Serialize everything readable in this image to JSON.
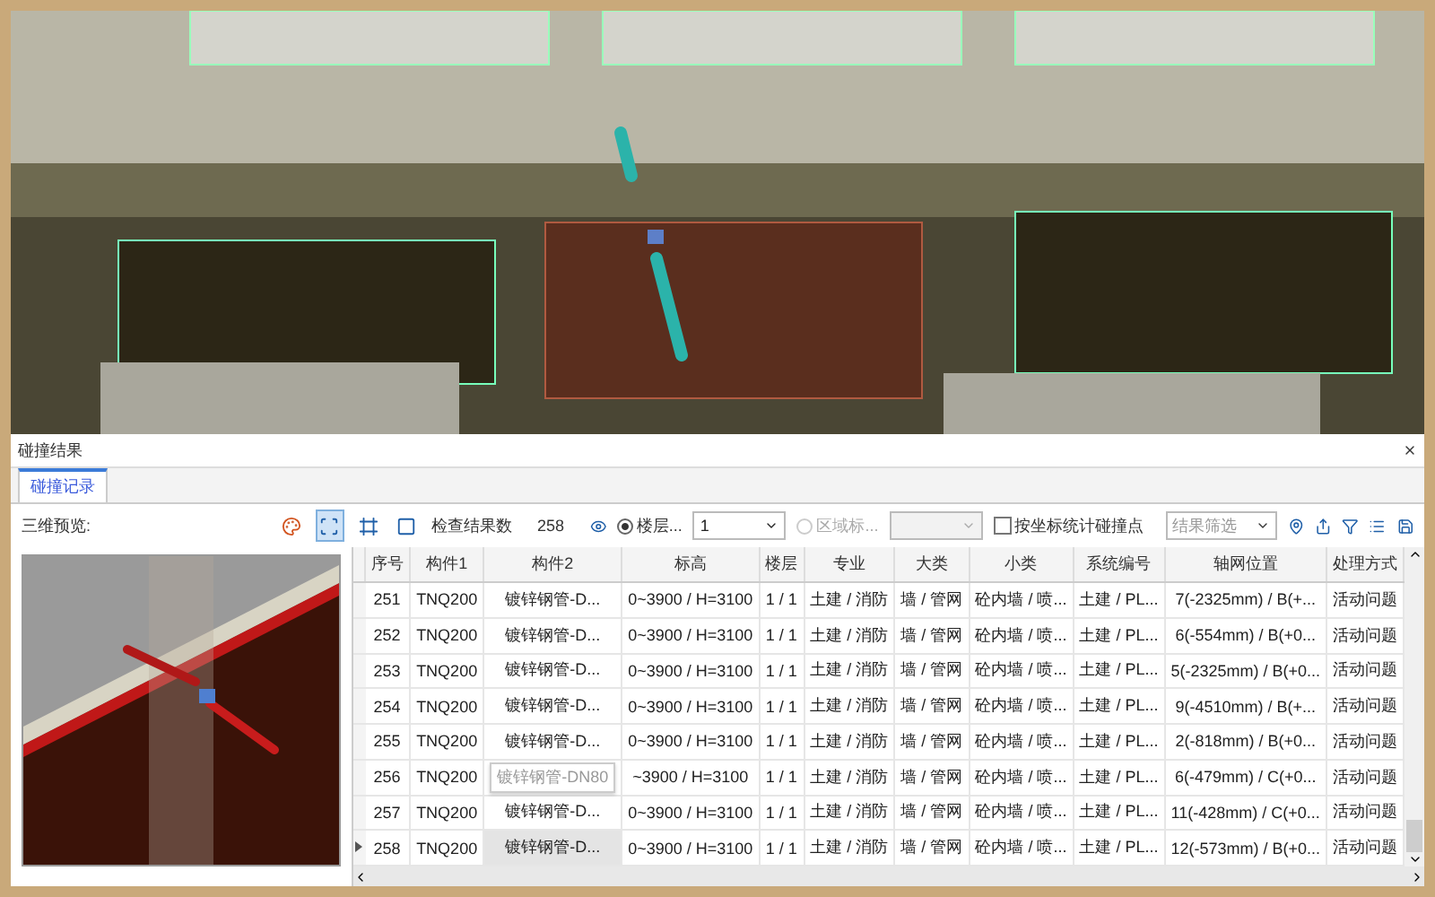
{
  "panel": {
    "title": "碰撞结果"
  },
  "tabs": [
    {
      "label": "碰撞记录",
      "selected": true
    }
  ],
  "toolbar": {
    "preview_label": "三维预览:",
    "tools": [
      {
        "kind": "color",
        "selected": false
      },
      {
        "kind": "fit",
        "selected": true
      },
      {
        "kind": "frame",
        "selected": false
      },
      {
        "kind": "window",
        "selected": false
      }
    ],
    "count_label": "检查结果数",
    "count": "258",
    "floor_radio": {
      "label": "楼层...",
      "selected": true
    },
    "floor_select": {
      "value": "1"
    },
    "area_radio": {
      "label": "区域标...",
      "selected": false,
      "disabled": true
    },
    "stat_checkbox": {
      "label": "按坐标统计碰撞点",
      "checked": false
    },
    "filter_select": {
      "placeholder": "结果筛选"
    }
  },
  "table": {
    "columns": [
      "序号",
      "构件1",
      "构件2",
      "标高",
      "楼层",
      "专业",
      "大类",
      "小类",
      "系统编号",
      "轴网位置",
      "处理方式"
    ],
    "rows": [
      {
        "selected": false,
        "hovered": false,
        "cells": [
          "251",
          "TNQ200",
          "镀锌钢管-D...",
          "0~3900 / H=3100",
          "1 / 1",
          "土建 / 消防",
          "墙 / 管网",
          "砼内墙 / 喷...",
          "土建 / PL...",
          "7(-2325mm) / B(+...",
          "活动问题"
        ]
      },
      {
        "selected": false,
        "hovered": false,
        "cells": [
          "252",
          "TNQ200",
          "镀锌钢管-D...",
          "0~3900 / H=3100",
          "1 / 1",
          "土建 / 消防",
          "墙 / 管网",
          "砼内墙 / 喷...",
          "土建 / PL...",
          "6(-554mm) / B(+0...",
          "活动问题"
        ]
      },
      {
        "selected": false,
        "hovered": false,
        "cells": [
          "253",
          "TNQ200",
          "镀锌钢管-D...",
          "0~3900 / H=3100",
          "1 / 1",
          "土建 / 消防",
          "墙 / 管网",
          "砼内墙 / 喷...",
          "土建 / PL...",
          "5(-2325mm) / B(+0...",
          "活动问题"
        ]
      },
      {
        "selected": false,
        "hovered": false,
        "cells": [
          "254",
          "TNQ200",
          "镀锌钢管-D...",
          "0~3900 / H=3100",
          "1 / 1",
          "土建 / 消防",
          "墙 / 管网",
          "砼内墙 / 喷...",
          "土建 / PL...",
          "9(-4510mm) / B(+...",
          "活动问题"
        ]
      },
      {
        "selected": false,
        "hovered": false,
        "cells": [
          "255",
          "TNQ200",
          "镀锌钢管-D...",
          "0~3900 / H=3100",
          "1 / 1",
          "土建 / 消防",
          "墙 / 管网",
          "砼内墙 / 喷...",
          "土建 / PL...",
          "2(-818mm) / B(+0...",
          "活动问题"
        ]
      },
      {
        "selected": false,
        "hovered": true,
        "cells": [
          "256",
          "TNQ200",
          "镀锌钢管-DN80",
          "~3900 / H=3100",
          "1 / 1",
          "土建 / 消防",
          "墙 / 管网",
          "砼内墙 / 喷...",
          "土建 / PL...",
          "6(-479mm) / C(+0...",
          "活动问题"
        ]
      },
      {
        "selected": false,
        "hovered": false,
        "cells": [
          "257",
          "TNQ200",
          "镀锌钢管-D...",
          "0~3900 / H=3100",
          "1 / 1",
          "土建 / 消防",
          "墙 / 管网",
          "砼内墙 / 喷...",
          "土建 / PL...",
          "11(-428mm) / C(+0...",
          "活动问题"
        ]
      },
      {
        "selected": true,
        "hovered": false,
        "cells": [
          "258",
          "TNQ200",
          "镀锌钢管-D...",
          "0~3900 / H=3100",
          "1 / 1",
          "土建 / 消防",
          "墙 / 管网",
          "砼内墙 / 喷...",
          "土建 / PL...",
          "12(-573mm) / B(+0...",
          "活动问题"
        ]
      }
    ]
  }
}
